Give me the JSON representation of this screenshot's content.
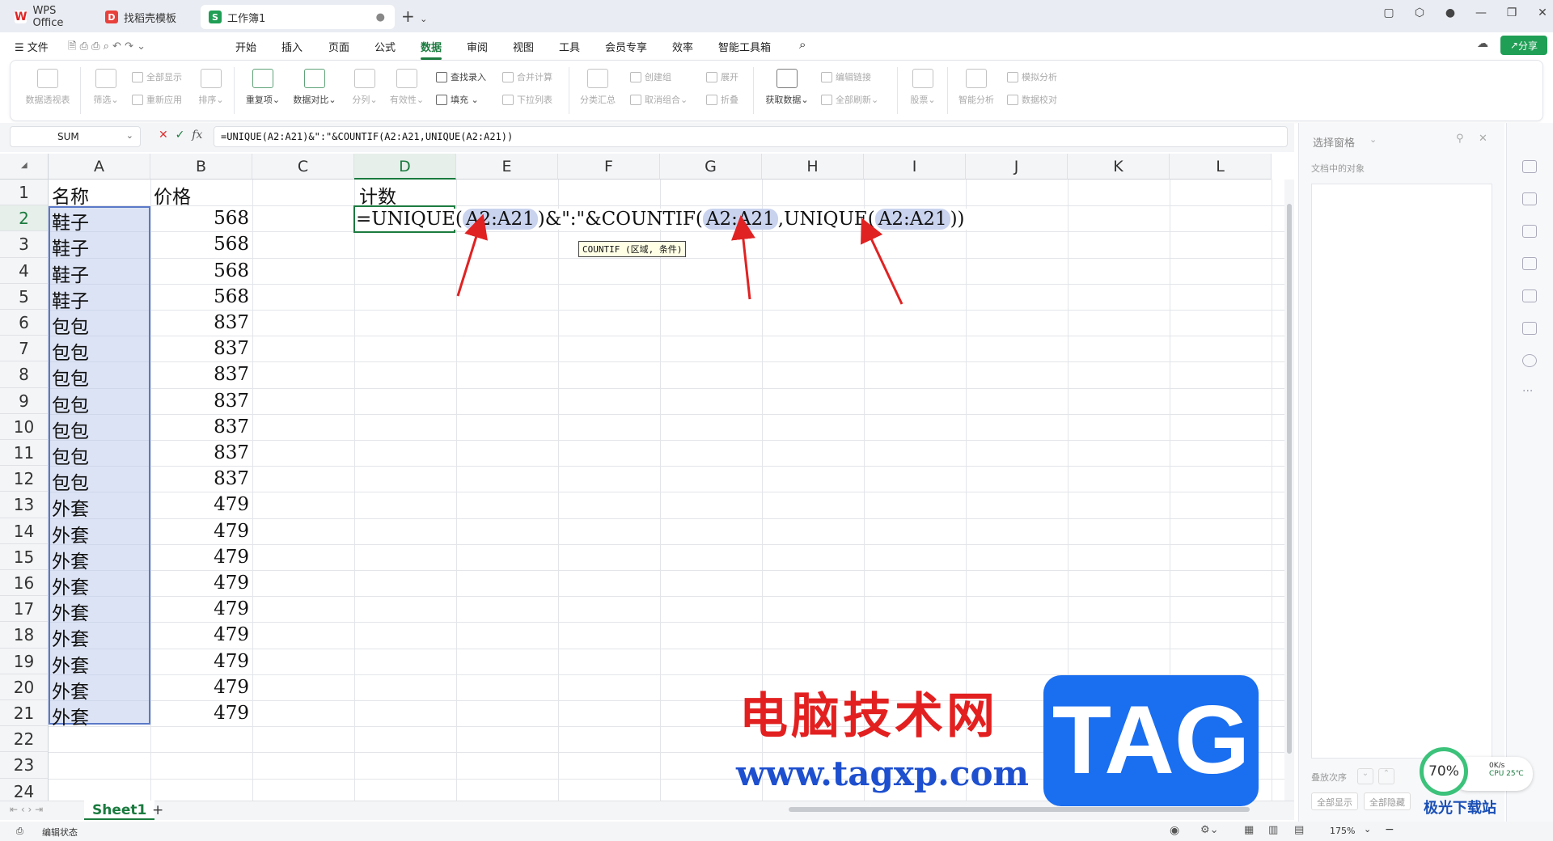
{
  "tabs": [
    {
      "label": "WPS Office",
      "icon": "wps-logo-icon"
    },
    {
      "label": "找稻壳模板",
      "icon": "docer-icon"
    },
    {
      "label": "工作簿1",
      "icon": "sheet-icon"
    }
  ],
  "menu": {
    "file": "文件",
    "items": [
      "开始",
      "插入",
      "页面",
      "公式",
      "数据",
      "审阅",
      "视图",
      "工具",
      "会员专享",
      "效率",
      "智能工具箱"
    ],
    "active": "数据",
    "share": "分享"
  },
  "ribbon": {
    "pivot": "数据透视表",
    "filter": "筛选",
    "show_all": "全部显示",
    "reapply": "重新应用",
    "sort": "排序",
    "duplicates": "重复项",
    "compare": "数据对比",
    "split": "分列",
    "validity": "有效性",
    "find_entry": "查找录入",
    "fill": "填充",
    "merge_calc": "合并计算",
    "dropdown": "下拉列表",
    "subtotal": "分类汇总",
    "create_group": "创建组",
    "ungroup": "取消组合",
    "expand": "展开",
    "fold": "折叠",
    "get_data": "获取数据",
    "edit_links": "编辑链接",
    "refresh_all": "全部刷新",
    "stocks": "股票",
    "smart_analysis": "智能分析",
    "simulation": "模拟分析",
    "proofread": "数据校对"
  },
  "formula_bar": {
    "name_box": "SUM",
    "fx": "fx",
    "formula": "=UNIQUE(A2:A21)&\":\"&COUNTIF(A2:A21,UNIQUE(A2:A21))"
  },
  "columns": [
    "A",
    "B",
    "C",
    "D",
    "E",
    "F",
    "G",
    "H",
    "I",
    "J",
    "K",
    "L"
  ],
  "rows": [
    "1",
    "2",
    "3",
    "4",
    "5",
    "6",
    "7",
    "8",
    "9",
    "10",
    "11",
    "12",
    "13",
    "14",
    "15",
    "16",
    "17",
    "18",
    "19",
    "20",
    "21",
    "22",
    "23",
    "24"
  ],
  "cells": {
    "A1": "名称",
    "B1": "价格",
    "D1": "计数",
    "colA": [
      "鞋子",
      "鞋子",
      "鞋子",
      "鞋子",
      "包包",
      "包包",
      "包包",
      "包包",
      "包包",
      "包包",
      "包包",
      "外套",
      "外套",
      "外套",
      "外套",
      "外套",
      "外套",
      "外套",
      "外套",
      "外套"
    ],
    "colB": [
      "568",
      "568",
      "568",
      "568",
      "837",
      "837",
      "837",
      "837",
      "837",
      "837",
      "837",
      "479",
      "479",
      "479",
      "479",
      "479",
      "479",
      "479",
      "479",
      "479"
    ]
  },
  "inline_formula": {
    "p1": "=UNIQUE(",
    "r1": "A2:A21",
    "p2": ")&\":\"&COUNTIF(",
    "r2": "A2:A21",
    "p3": ",UNIQUE(",
    "r3": "A2:A21",
    "p4": "))"
  },
  "tooltip": "COUNTIF (区域, 条件)",
  "sheet": {
    "name": "Sheet1",
    "add": "+"
  },
  "status": {
    "mode": "编辑状态",
    "zoom": "175%"
  },
  "side_panel": {
    "title": "选择窗格",
    "objects": "文档中的对象",
    "order": "叠放次序",
    "show_all": "全部显示",
    "hide_all": "全部隐藏"
  },
  "watermark": {
    "title": "电脑技术网",
    "url": "www.tagxp.com",
    "tag": "TAG",
    "site": "极光下载站"
  },
  "cpu": {
    "percent": "70%",
    "speed": "0K/s",
    "temp": "CPU 25℃"
  },
  "colors": {
    "accent": "#1b7b3f",
    "selection": "#c0ccec",
    "arrow": "#e02222"
  }
}
